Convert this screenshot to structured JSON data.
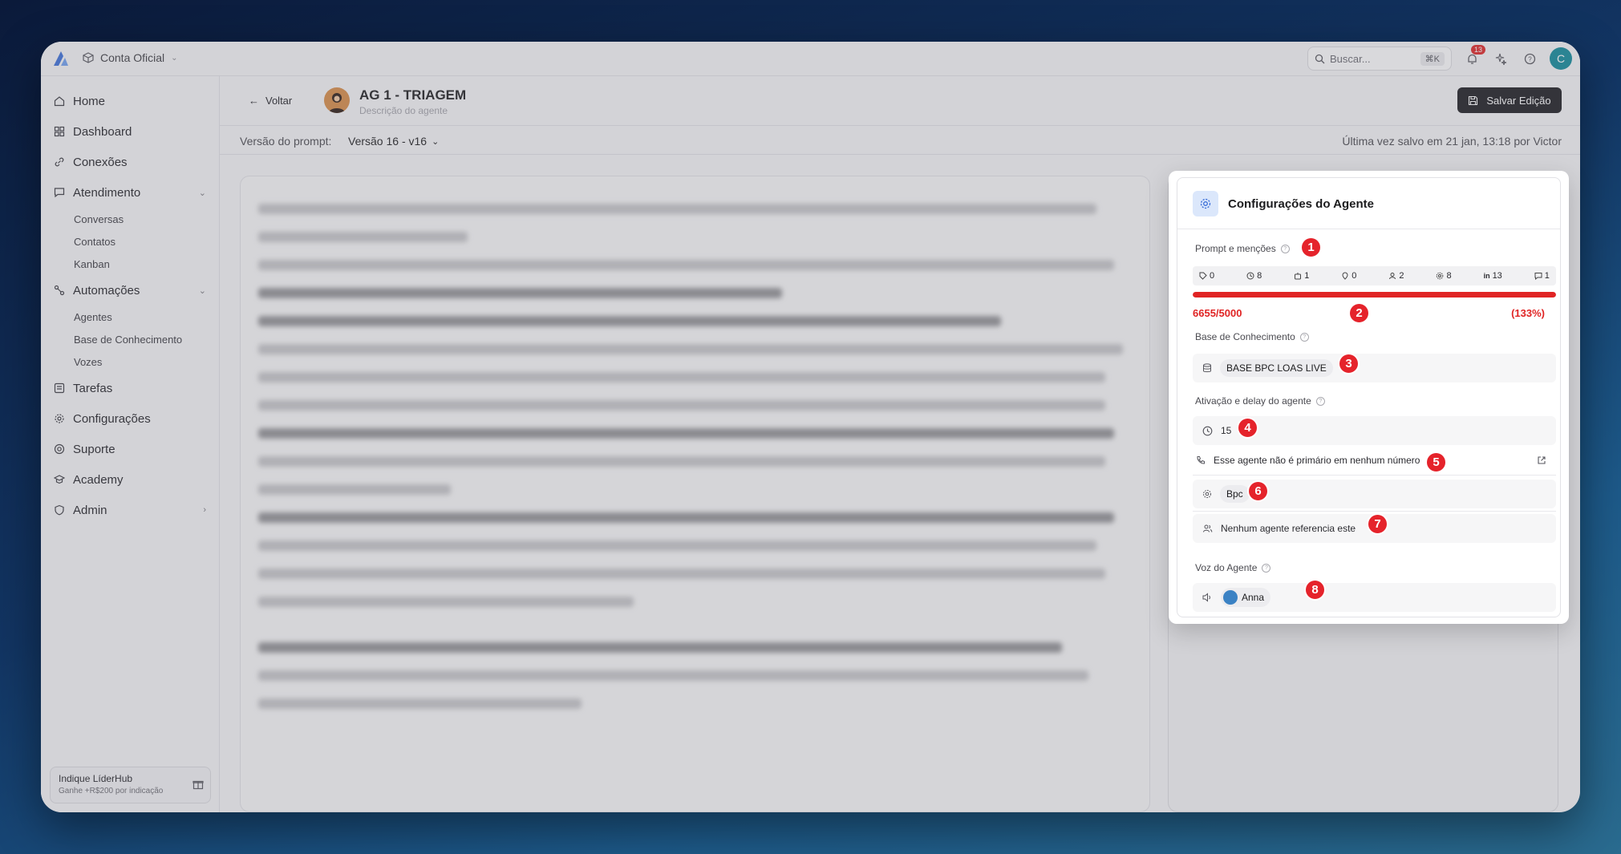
{
  "topbar": {
    "account_label": "Conta Oficial",
    "search_placeholder": "Buscar...",
    "search_shortcut": "⌘K",
    "notification_count": "13",
    "user_initial": "C"
  },
  "sidebar": {
    "items": [
      {
        "label": "Home",
        "icon": "home-icon"
      },
      {
        "label": "Dashboard",
        "icon": "dashboard-icon"
      },
      {
        "label": "Conexões",
        "icon": "link-icon"
      },
      {
        "label": "Atendimento",
        "icon": "message-icon",
        "expanded": true,
        "children": [
          "Conversas",
          "Contatos",
          "Kanban"
        ]
      },
      {
        "label": "Automações",
        "icon": "automation-icon",
        "expanded": true,
        "children": [
          "Agentes",
          "Base de Conhecimento",
          "Vozes"
        ]
      },
      {
        "label": "Tarefas",
        "icon": "tasks-icon"
      },
      {
        "label": "Configurações",
        "icon": "gear-icon"
      },
      {
        "label": "Suporte",
        "icon": "lifebuoy-icon"
      },
      {
        "label": "Academy",
        "icon": "graduation-cap-icon"
      },
      {
        "label": "Admin",
        "icon": "shield-icon"
      }
    ],
    "referral": {
      "title": "Indique LíderHub",
      "subtitle": "Ganhe +R$200 por indicação"
    }
  },
  "header": {
    "back_label": "Voltar",
    "agent_title": "AG 1 - TRIAGEM",
    "agent_description": "Descrição do agente",
    "save_label": "Salvar Edição"
  },
  "version": {
    "label": "Versão do prompt:",
    "selected": "Versão 16 - v16",
    "last_saved": "Última vez salvo em 21 jan, 13:18 por Victor"
  },
  "settings_panel": {
    "title": "Configurações do Agente",
    "prompt_section": {
      "label": "Prompt e menções",
      "stats": [
        {
          "icon": "tag-icon",
          "value": "0"
        },
        {
          "icon": "clock-icon",
          "value": "8"
        },
        {
          "icon": "robot-icon",
          "value": "1"
        },
        {
          "icon": "pin-icon",
          "value": "0"
        },
        {
          "icon": "user-icon",
          "value": "2"
        },
        {
          "icon": "gear-icon",
          "value": "8"
        },
        {
          "icon": "linkedin-icon",
          "value": "13"
        },
        {
          "icon": "chat-icon",
          "value": "1"
        }
      ],
      "char_count": "6655/5000",
      "percent": "(133%)",
      "progress_fraction": 1.0,
      "progress_color": "#e02424"
    },
    "knowledge_section": {
      "label": "Base de Conhecimento",
      "value": "BASE BPC LOAS LIVE"
    },
    "activation_section": {
      "label": "Ativação e delay do agente",
      "delay_value": "15",
      "primary_text": "Esse agente não é primário em nenhum número",
      "tag_value": "Bpc",
      "references_text": "Nenhum agente referencia este"
    },
    "voice_section": {
      "label": "Voz do Agente",
      "voice_name": "Anna"
    },
    "callouts": [
      "1",
      "2",
      "3",
      "4",
      "5",
      "6",
      "7",
      "8"
    ]
  },
  "colors": {
    "accent": "#e02424",
    "primary_button": "#1b1b1f",
    "callout": "#e5232b"
  }
}
